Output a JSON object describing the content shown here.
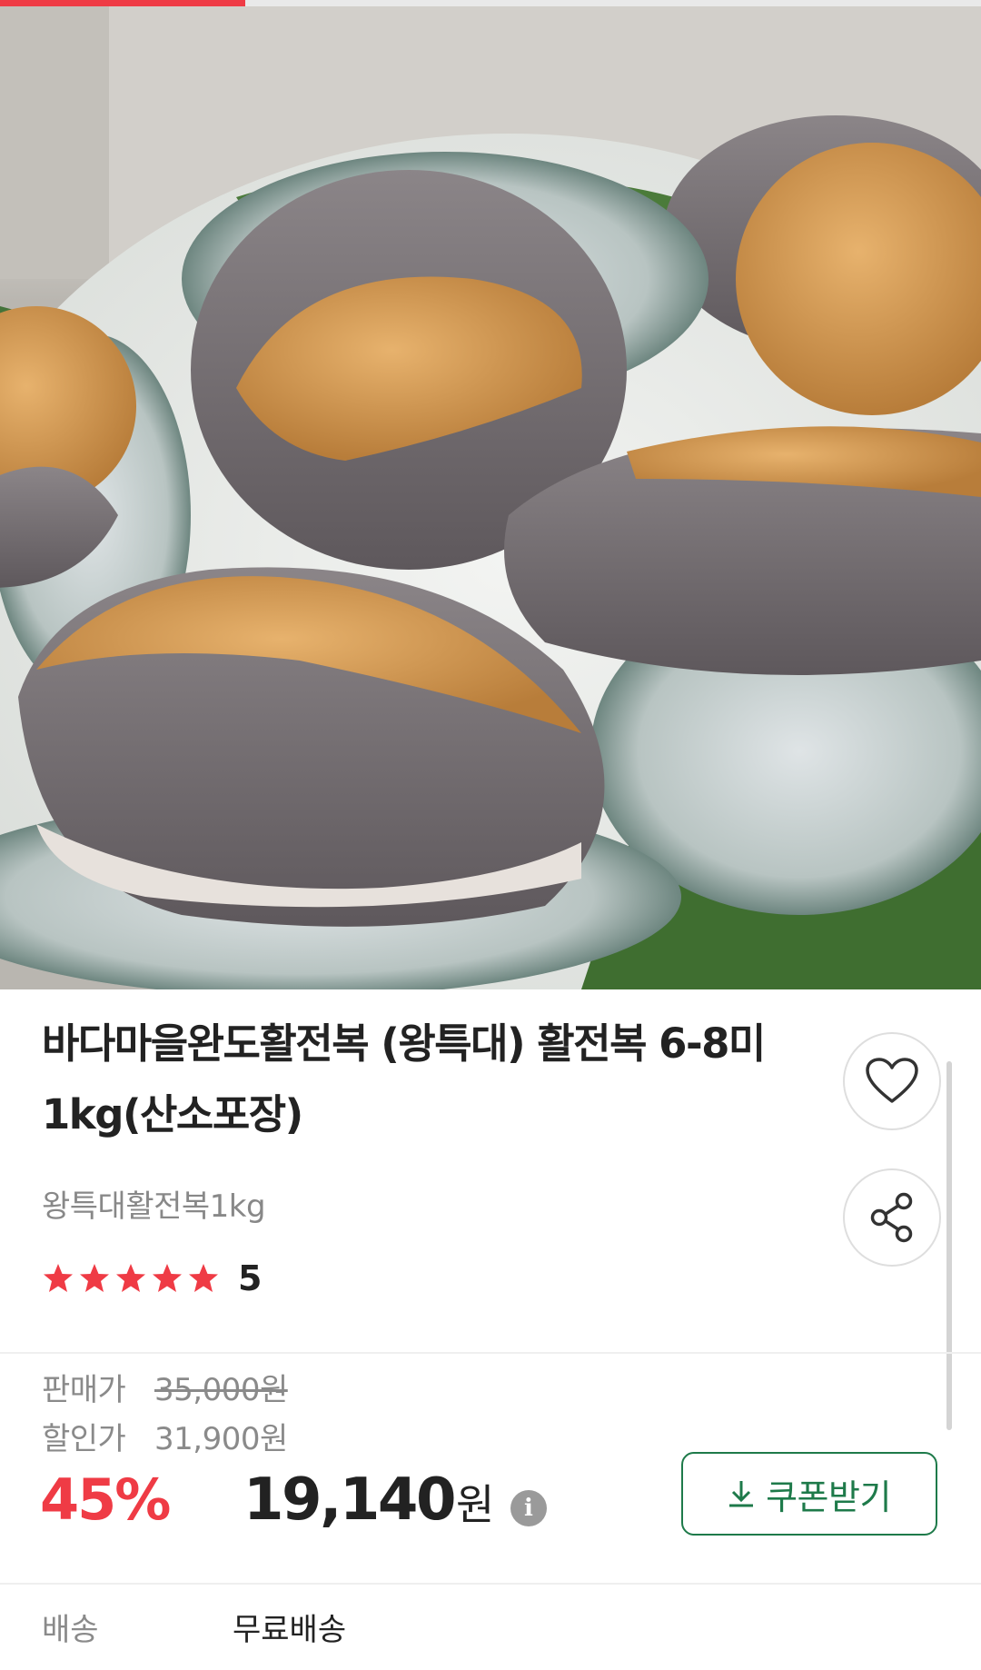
{
  "progress": {
    "fraction": 0.25,
    "color": "#ef3b45"
  },
  "product": {
    "title": "바다마을완도활전복 (왕특대) 활전복 6-8미1kg(산소포장)",
    "subtitle": "왕특대활전복1kg",
    "rating": {
      "stars": 5,
      "value": "5"
    }
  },
  "actions": {
    "wish_icon": "heart-icon",
    "share_icon": "share-icon"
  },
  "price": {
    "sale_label": "판매가",
    "sale_price": "35,000원",
    "discount_label": "할인가",
    "discount_price": "31,900원",
    "discount_rate": "45%",
    "final_price": "19,140",
    "final_unit": "원",
    "info_icon": "i"
  },
  "coupon": {
    "label": "쿠폰받기",
    "icon": "download-icon",
    "color": "#1e7a4a"
  },
  "shipping": {
    "label": "배송",
    "value": "무료배송"
  },
  "colors": {
    "accent": "#ef3b45",
    "text": "#222222",
    "muted": "#8a8a8a"
  }
}
